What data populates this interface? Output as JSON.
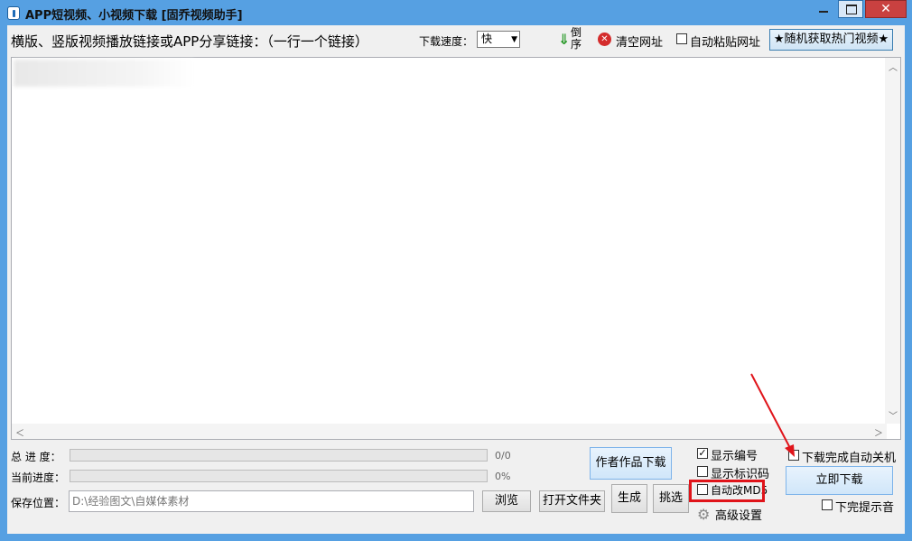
{
  "window": {
    "title": "APP短视频、小视频下载 [固乔视频助手]",
    "close_label": "✕"
  },
  "toolbar": {
    "prompt": "横版、竖版视频播放链接或APP分享链接：（一行一个链接）",
    "speed_label": "下载速度：",
    "speed_value": "快",
    "reverse_label": "倒序",
    "clear_label": "清空网址",
    "auto_paste_label": "自动粘贴网址",
    "auto_paste_checked": false,
    "hot_button_label": "★随机获取热门视频★"
  },
  "progress": {
    "total_label": "总 进 度：",
    "total_value": "0/0",
    "total_fraction": 0,
    "current_label": "当前进度：",
    "current_value": "0%",
    "current_fraction": 0
  },
  "save": {
    "label": "保存位置：",
    "path": "D:\\经验图文\\自媒体素材",
    "browse_label": "浏览",
    "open_folder_label": "打开文件夹"
  },
  "actions": {
    "author_download_label": "作者作品下载",
    "generate_label": "生成",
    "pick_label": "挑选",
    "download_now_label": "立即下载"
  },
  "options": {
    "show_number_label": "显示编号",
    "show_number_checked": true,
    "show_id_label": "显示标识码",
    "show_id_checked": false,
    "auto_md5_label": "自动改MD5",
    "auto_md5_checked": false,
    "advanced_label": "高级设置",
    "shutdown_label": "下载完成自动关机",
    "shutdown_checked": false,
    "notify_label": "下完提示音",
    "notify_checked": false
  },
  "colors": {
    "title_bar": "#56a0e2",
    "highlight_box": "#e0141a",
    "progress_fill": "#06b025"
  }
}
